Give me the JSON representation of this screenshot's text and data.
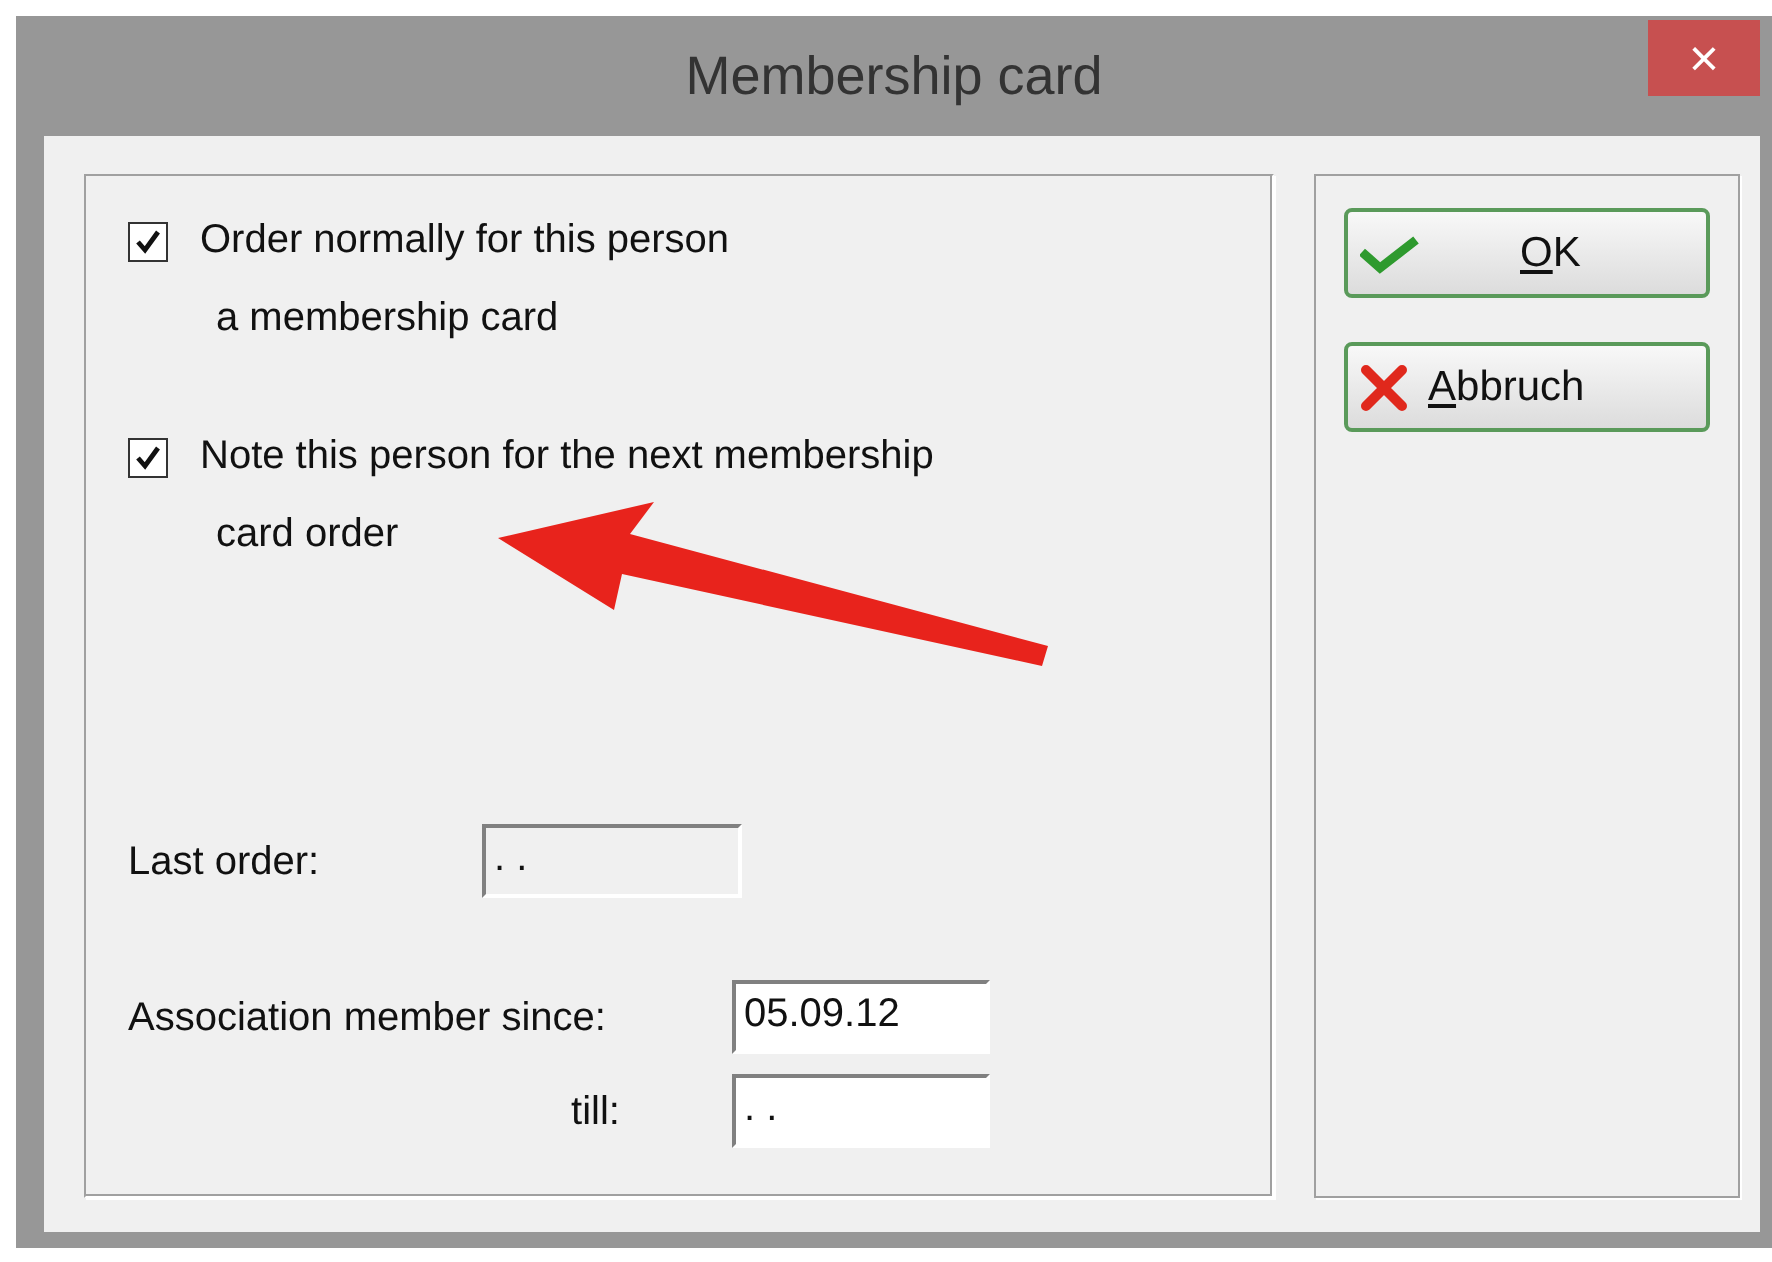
{
  "window": {
    "title": "Membership card",
    "close": "×"
  },
  "options": [
    {
      "lines": [
        "Order normally for this person",
        "a membership card"
      ],
      "checked": true
    },
    {
      "lines": [
        "Note this person for the next membership",
        "card order"
      ],
      "checked": true
    }
  ],
  "last_order": {
    "label": "Last order:",
    "value": ". .",
    "disabled": true
  },
  "member_since": {
    "label": "Association member since:",
    "value": "05.09.12"
  },
  "member_till": {
    "label": "till:",
    "value": ". ."
  },
  "buttons": [
    {
      "kind": "ok",
      "mnemonic": "O",
      "rest": "K"
    },
    {
      "kind": "cancel",
      "mnemonic": "A",
      "rest": "bbruch"
    }
  ]
}
